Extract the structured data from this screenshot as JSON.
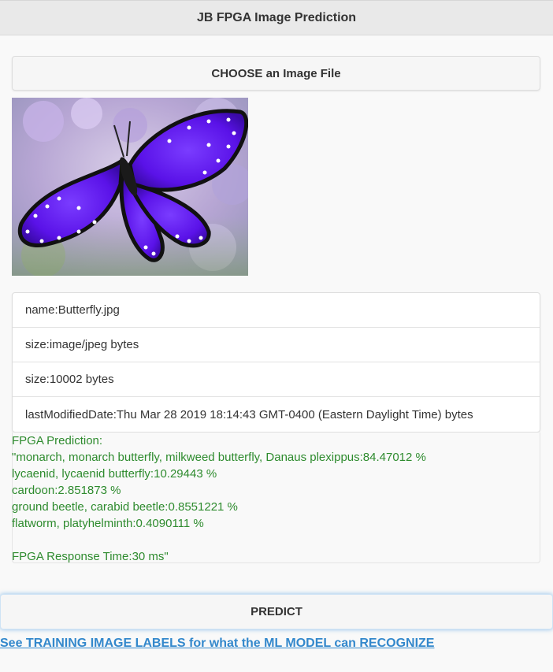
{
  "header": {
    "title": "JB FPGA Image Prediction"
  },
  "choose_button": {
    "label": "CHOOSE an Image File"
  },
  "preview": {
    "subject": "butterfly-photo"
  },
  "file_info": [
    "name:Butterfly.jpg",
    "size:image/jpeg bytes",
    "size:10002 bytes",
    "lastModifiedDate:Thu Mar 28 2019 18:14:43 GMT-0400 (Eastern Daylight Time) bytes"
  ],
  "prediction": {
    "lines": [
      "FPGA Prediction:",
      "\"monarch, monarch butterfly, milkweed butterfly, Danaus plexippus:84.47012 %",
      "lycaenid, lycaenid butterfly:10.29443 %",
      "cardoon:2.851873 %",
      "ground beetle, carabid beetle:0.8551221 %",
      "flatworm, platyhelminth:0.4090111 %",
      "",
      "FPGA Response Time:30 ms\""
    ],
    "color": "#2e8b2e"
  },
  "predict_button": {
    "label": "PREDICT"
  },
  "labels_link": {
    "text": "See TRAINING IMAGE LABELS for what the ML MODEL can RECOGNIZE",
    "color": "#3388cc"
  }
}
